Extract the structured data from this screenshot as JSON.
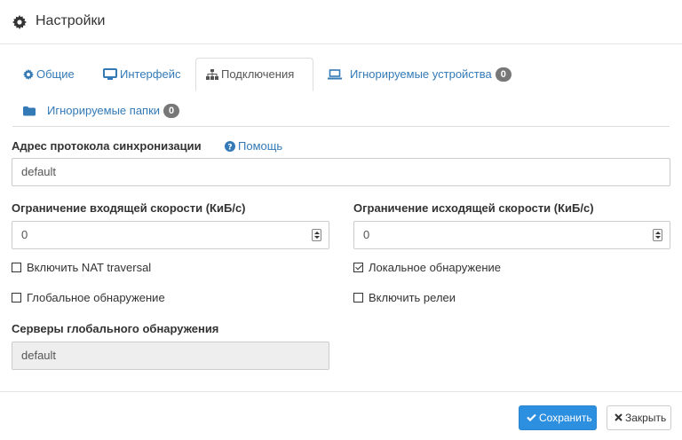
{
  "header": {
    "title": "Настройки",
    "icon": "gear-icon"
  },
  "tabs": [
    {
      "label": "Общие",
      "icon": "gear-icon"
    },
    {
      "label": "Интерфейс",
      "icon": "monitor-icon"
    },
    {
      "label": "Подключения",
      "icon": "sitemap-icon",
      "active": true
    },
    {
      "label": "Игнорируемые устройства",
      "icon": "laptop-icon",
      "badge": "0"
    },
    {
      "label": "Игнорируемые папки",
      "icon": "folder-icon",
      "badge": "0"
    }
  ],
  "sync_protocol": {
    "label": "Адрес протокола синхронизации",
    "help": "Помощь",
    "value": "default"
  },
  "incoming_rate": {
    "label": "Ограничение входящей скорости (КиБ/с)",
    "value": "0"
  },
  "outgoing_rate": {
    "label": "Ограничение исходящей скорости (КиБ/с)",
    "value": "0"
  },
  "checkboxes": {
    "nat": {
      "label": "Включить NAT traversal",
      "checked": false
    },
    "global_discovery": {
      "label": "Глобальное обнаружение",
      "checked": false
    },
    "local_discovery": {
      "label": "Локальное обнаружение",
      "checked": true
    },
    "relays": {
      "label": "Включить релеи",
      "checked": false
    }
  },
  "global_servers": {
    "label": "Серверы глобального обнаружения",
    "value": "default"
  },
  "footer": {
    "save_label": "Сохранить",
    "close_label": "Закрыть"
  },
  "colors": {
    "link": "#337ab7",
    "primary": "#2d8fe0",
    "badge": "#777777"
  }
}
